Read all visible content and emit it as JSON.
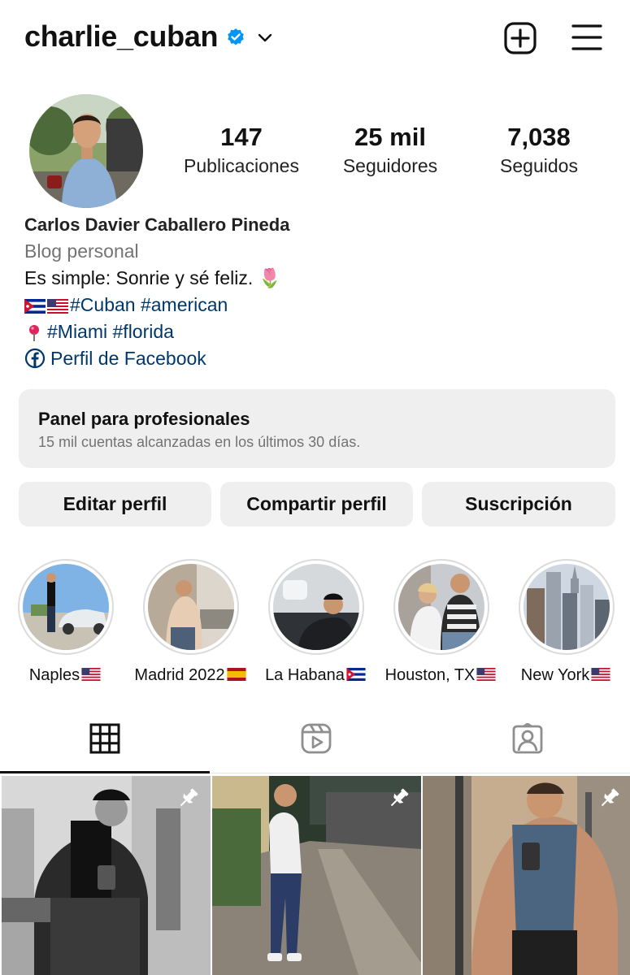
{
  "header": {
    "username": "charlie_cuban",
    "verified": true
  },
  "stats": [
    {
      "value": "147",
      "label": "Publicaciones"
    },
    {
      "value": "25 mil",
      "label": "Seguidores"
    },
    {
      "value": "7,038",
      "label": "Seguidos"
    }
  ],
  "bio": {
    "full_name": "Carlos Davier Caballero Pineda",
    "category": "Blog personal",
    "line1": "Es simple: Sonrie y sé feliz. 🌷",
    "line2_tags": "#Cuban #american",
    "line3_tags": "#Miami #florida",
    "facebook_link": "Perfil de Facebook"
  },
  "dashboard": {
    "title": "Panel para profesionales",
    "subtitle": "15 mil cuentas alcanzadas en los últimos 30 días."
  },
  "actions": {
    "edit": "Editar perfil",
    "share": "Compartir perfil",
    "subscription": "Suscripción"
  },
  "highlights": [
    {
      "label": "Naples",
      "flag": "us"
    },
    {
      "label": "Madrid 2022",
      "flag": "es"
    },
    {
      "label": "La Habana",
      "flag": "cu"
    },
    {
      "label": "Houston, TX",
      "flag": "us"
    },
    {
      "label": "New York",
      "flag": "us"
    }
  ],
  "tabs": [
    {
      "icon": "grid-icon",
      "active": true
    },
    {
      "icon": "reels-icon",
      "active": false
    },
    {
      "icon": "tagged-icon",
      "active": false
    }
  ],
  "colors": {
    "verified_blue": "#0095f6",
    "link_blue": "#00376b",
    "button_gray": "#efefef",
    "muted_text": "#737373"
  }
}
